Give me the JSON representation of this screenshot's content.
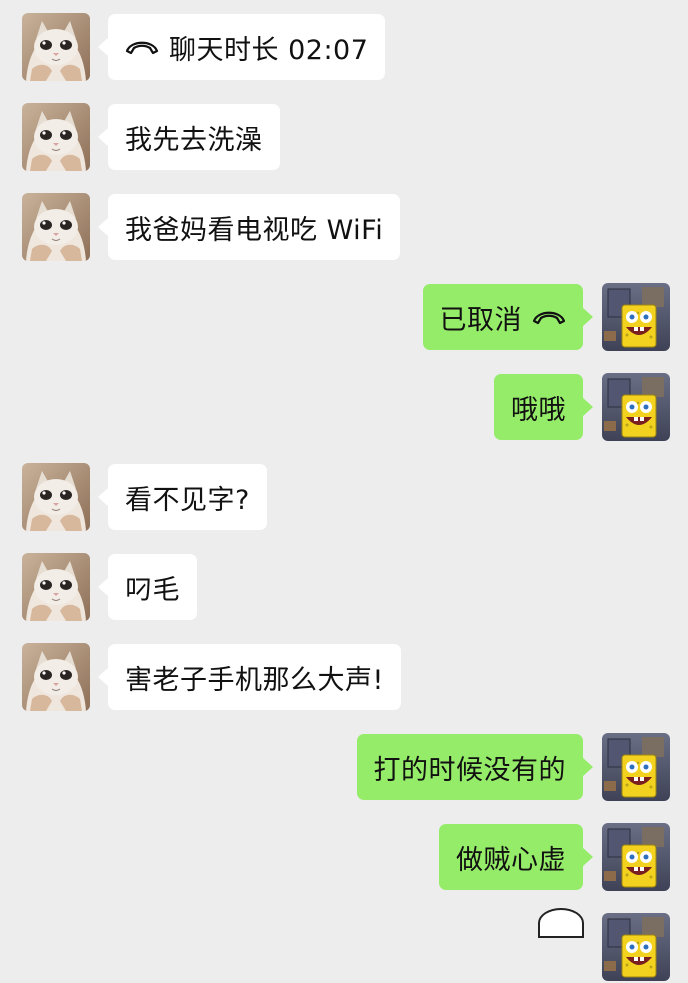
{
  "colors": {
    "background": "#ededed",
    "incoming_bubble": "#ffffff",
    "outgoing_bubble": "#95ec69",
    "text": "#111111"
  },
  "avatars": {
    "contact": "cat-avatar",
    "self": "spongebob-avatar"
  },
  "messages": [
    {
      "direction": "in",
      "icon": "phone-hangup-icon",
      "text": "聊天时长 02:07"
    },
    {
      "direction": "in",
      "text": "我先去洗澡"
    },
    {
      "direction": "in",
      "text": "我爸妈看电视吃 WiFi"
    },
    {
      "direction": "out",
      "icon": "phone-hangup-icon",
      "text": "已取消"
    },
    {
      "direction": "out",
      "text": "哦哦"
    },
    {
      "direction": "in",
      "text": "看不见字?"
    },
    {
      "direction": "in",
      "text": "叼毛"
    },
    {
      "direction": "in",
      "text": "害老子手机那么大声!"
    },
    {
      "direction": "out",
      "text": "打的时候没有的"
    },
    {
      "direction": "out",
      "text": "做贼心虚"
    }
  ]
}
